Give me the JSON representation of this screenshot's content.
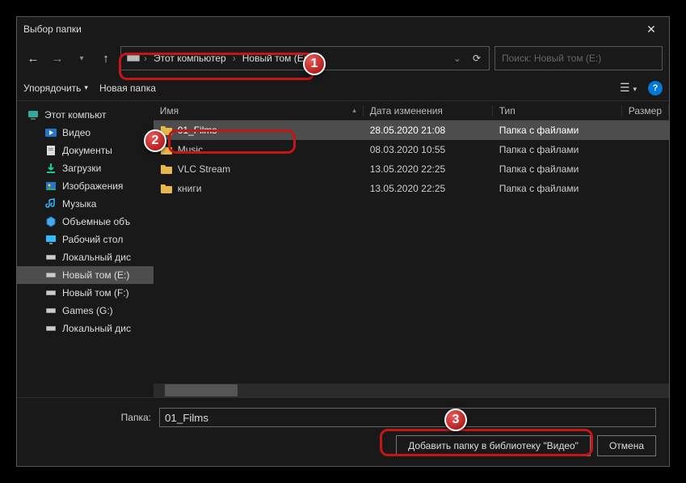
{
  "title": "Выбор папки",
  "nav": {
    "back": "←",
    "fwd": "→",
    "up": "↑"
  },
  "breadcrumb": {
    "item1": "Этот компьютер",
    "item2": "Новый том (E:)"
  },
  "search": {
    "placeholder": "Поиск: Новый том (E:)"
  },
  "toolbar": {
    "organize": "Упорядочить",
    "newfolder": "Новая папка"
  },
  "sidebar": [
    {
      "label": "Этот компьют",
      "icon": "pc",
      "indent": 0
    },
    {
      "label": "Видео",
      "icon": "video",
      "indent": 1
    },
    {
      "label": "Документы",
      "icon": "doc",
      "indent": 1
    },
    {
      "label": "Загрузки",
      "icon": "down",
      "indent": 1
    },
    {
      "label": "Изображения",
      "icon": "pic",
      "indent": 1
    },
    {
      "label": "Музыка",
      "icon": "music",
      "indent": 1
    },
    {
      "label": "Объемные объ",
      "icon": "cube",
      "indent": 1
    },
    {
      "label": "Рабочий стол",
      "icon": "desk",
      "indent": 1
    },
    {
      "label": "Локальный дис",
      "icon": "disk",
      "indent": 1
    },
    {
      "label": "Новый том (E:)",
      "icon": "disk",
      "indent": 1,
      "selected": true
    },
    {
      "label": "Новый том (F:)",
      "icon": "disk",
      "indent": 1
    },
    {
      "label": "Games (G:)",
      "icon": "disk",
      "indent": 1
    },
    {
      "label": "Локальный дис",
      "icon": "disk",
      "indent": 1
    }
  ],
  "columns": {
    "name": "Имя",
    "date": "Дата изменения",
    "type": "Тип",
    "size": "Размер"
  },
  "rows": [
    {
      "name": "01_Films",
      "date": "28.05.2020 21:08",
      "type": "Папка с файлами",
      "selected": true
    },
    {
      "name": "Music",
      "date": "08.03.2020 10:55",
      "type": "Папка с файлами"
    },
    {
      "name": "VLC Stream",
      "date": "13.05.2020 22:25",
      "type": "Папка с файлами"
    },
    {
      "name": "книги",
      "date": "13.05.2020 22:25",
      "type": "Папка с файлами"
    }
  ],
  "footer": {
    "label": "Папка:",
    "value": "01_Films",
    "add": "Добавить папку в библиотеку \"Видео\"",
    "cancel": "Отмена"
  },
  "badges": {
    "b1": "1",
    "b2": "2",
    "b3": "3"
  }
}
